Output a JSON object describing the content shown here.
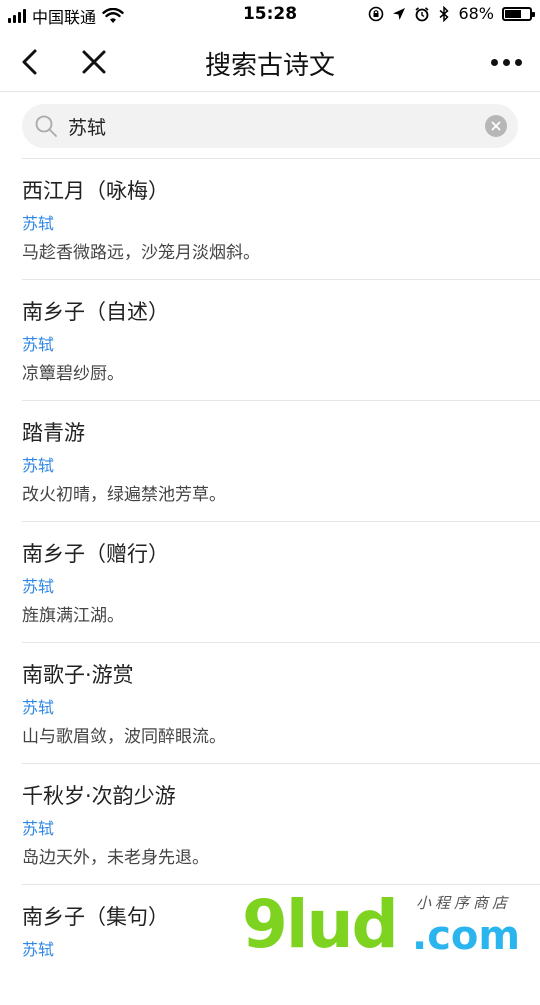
{
  "status": {
    "carrier": "中国联通",
    "time": "15:28",
    "battery_percent": "68%",
    "battery_level": 0.68
  },
  "nav": {
    "title": "搜索古诗文"
  },
  "search": {
    "value": "苏轼"
  },
  "results": [
    {
      "title": "西江月（咏梅）",
      "author": "苏轼",
      "line": "马趁香微路远，沙笼月淡烟斜。"
    },
    {
      "title": "南乡子（自述）",
      "author": "苏轼",
      "line": "凉簟碧纱厨。"
    },
    {
      "title": "踏青游",
      "author": "苏轼",
      "line": "改火初晴，绿遍禁池芳草。"
    },
    {
      "title": "南乡子（赠行）",
      "author": "苏轼",
      "line": "旌旗满江湖。"
    },
    {
      "title": "南歌子·游赏",
      "author": "苏轼",
      "line": "山与歌眉敛，波同醉眼流。"
    },
    {
      "title": "千秋岁·次韵少游",
      "author": "苏轼",
      "line": "岛边天外，未老身先退。"
    },
    {
      "title": "南乡子（集句）",
      "author": "苏轼",
      "line": ""
    }
  ],
  "watermark": {
    "main": "9lud",
    "com": ".com",
    "small": "小程序商店"
  },
  "colors": {
    "author_link": "#2f88e4",
    "watermark_green": "#7ed321",
    "watermark_blue": "#2bb5ef"
  },
  "icons": {
    "back": "chevron-left-icon",
    "close": "close-icon",
    "more": "more-dots-icon",
    "search": "search-icon",
    "clear": "clear-icon",
    "wifi": "wifi-icon",
    "location": "location-arrow-icon",
    "alarm": "alarm-icon",
    "bluetooth": "bluetooth-icon",
    "lock": "orientation-lock-icon"
  }
}
